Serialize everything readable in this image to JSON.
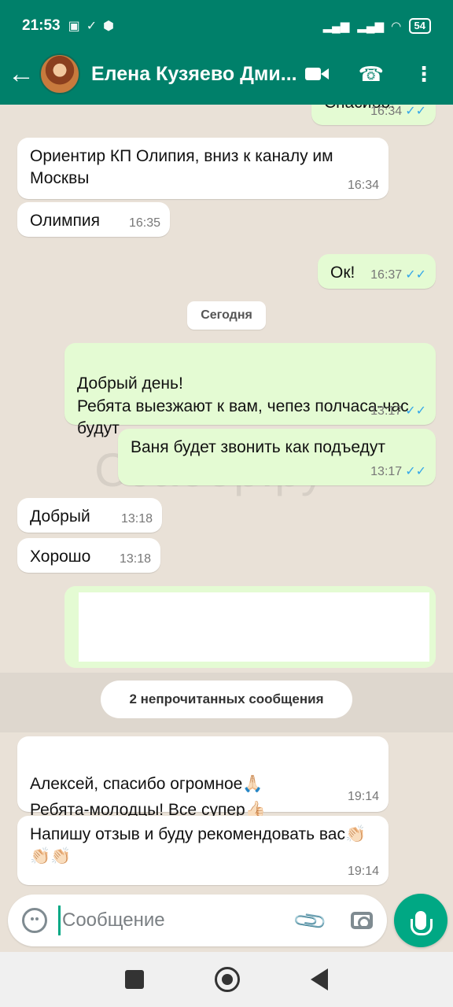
{
  "status": {
    "time": "21:53",
    "battery": "54"
  },
  "header": {
    "contact_name": "Елена Кузяево Дми..."
  },
  "chat": {
    "watermark": "Сзабор.ру",
    "date_chip": "Сегодня",
    "unread_chip": "2 непрочитанных сообщения",
    "messages": [
      {
        "text": "Спасибо!",
        "time": "16:34",
        "side": "out"
      },
      {
        "text": "Ориентир КП Олипия, вниз к каналу им Москвы",
        "time": "16:34",
        "side": "in"
      },
      {
        "text": "Олимпия",
        "time": "16:35",
        "side": "in"
      },
      {
        "text": "Ок!",
        "time": "16:37",
        "side": "out"
      },
      {
        "text": "Добрый день!\nРебята выезжают к вам, чепез полчаса-час будут",
        "time": "13:17",
        "side": "out"
      },
      {
        "text": "Ваня будет звонить как подъедут",
        "time": "13:17",
        "side": "out"
      },
      {
        "text": "Добрый",
        "time": "13:18",
        "side": "in"
      },
      {
        "text": "Хорошо",
        "time": "13:18",
        "side": "in"
      },
      {
        "text": "Алексей, спасибо огромное🙏🏻\nРебята-молодцы! Все супер👍🏻",
        "time": "19:14",
        "side": "in"
      },
      {
        "text": "Напишу отзыв и буду рекомендовать вас👏🏻👏🏻👏🏻",
        "time": "19:14",
        "side": "in"
      }
    ]
  },
  "input": {
    "placeholder": "Сообщение"
  },
  "colors": {
    "header": "#00806a",
    "outgoing_bubble": "#e4fbd3",
    "incoming_bubble": "#ffffff",
    "read_ticks": "#35a7e8",
    "accent": "#00a884"
  },
  "icons": {
    "back": "back-arrow-icon",
    "video": "video-call-icon",
    "phone": "voice-call-icon",
    "menu": "more-options-icon",
    "emoji": "emoji-icon",
    "attach": "paperclip-icon",
    "camera": "camera-icon",
    "mic": "microphone-icon"
  }
}
